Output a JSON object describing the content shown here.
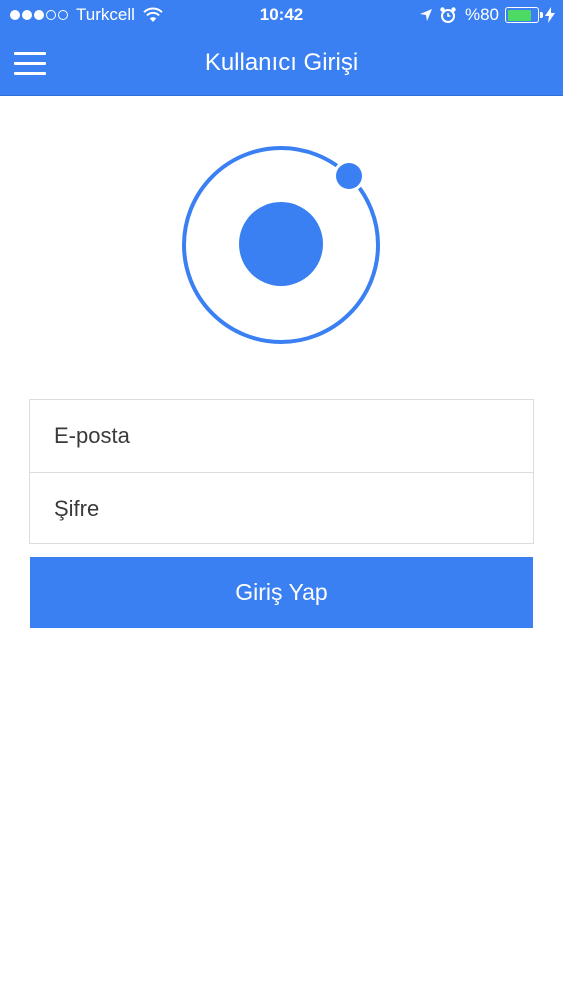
{
  "status_bar": {
    "carrier": "Turkcell",
    "time": "10:42",
    "battery": "%80",
    "battery_level": 0.8
  },
  "header": {
    "title": "Kullanıcı Girişi",
    "menu_icon": "hamburger-menu-icon"
  },
  "logo": {
    "icon": "ionic-logo-icon",
    "color": "#3a80f2"
  },
  "form": {
    "email_placeholder": "E-posta",
    "password_placeholder": "Şifre",
    "submit_label": "Giriş Yap"
  },
  "colors": {
    "primary": "#3a80f2",
    "battery_fill": "#4cd964"
  }
}
